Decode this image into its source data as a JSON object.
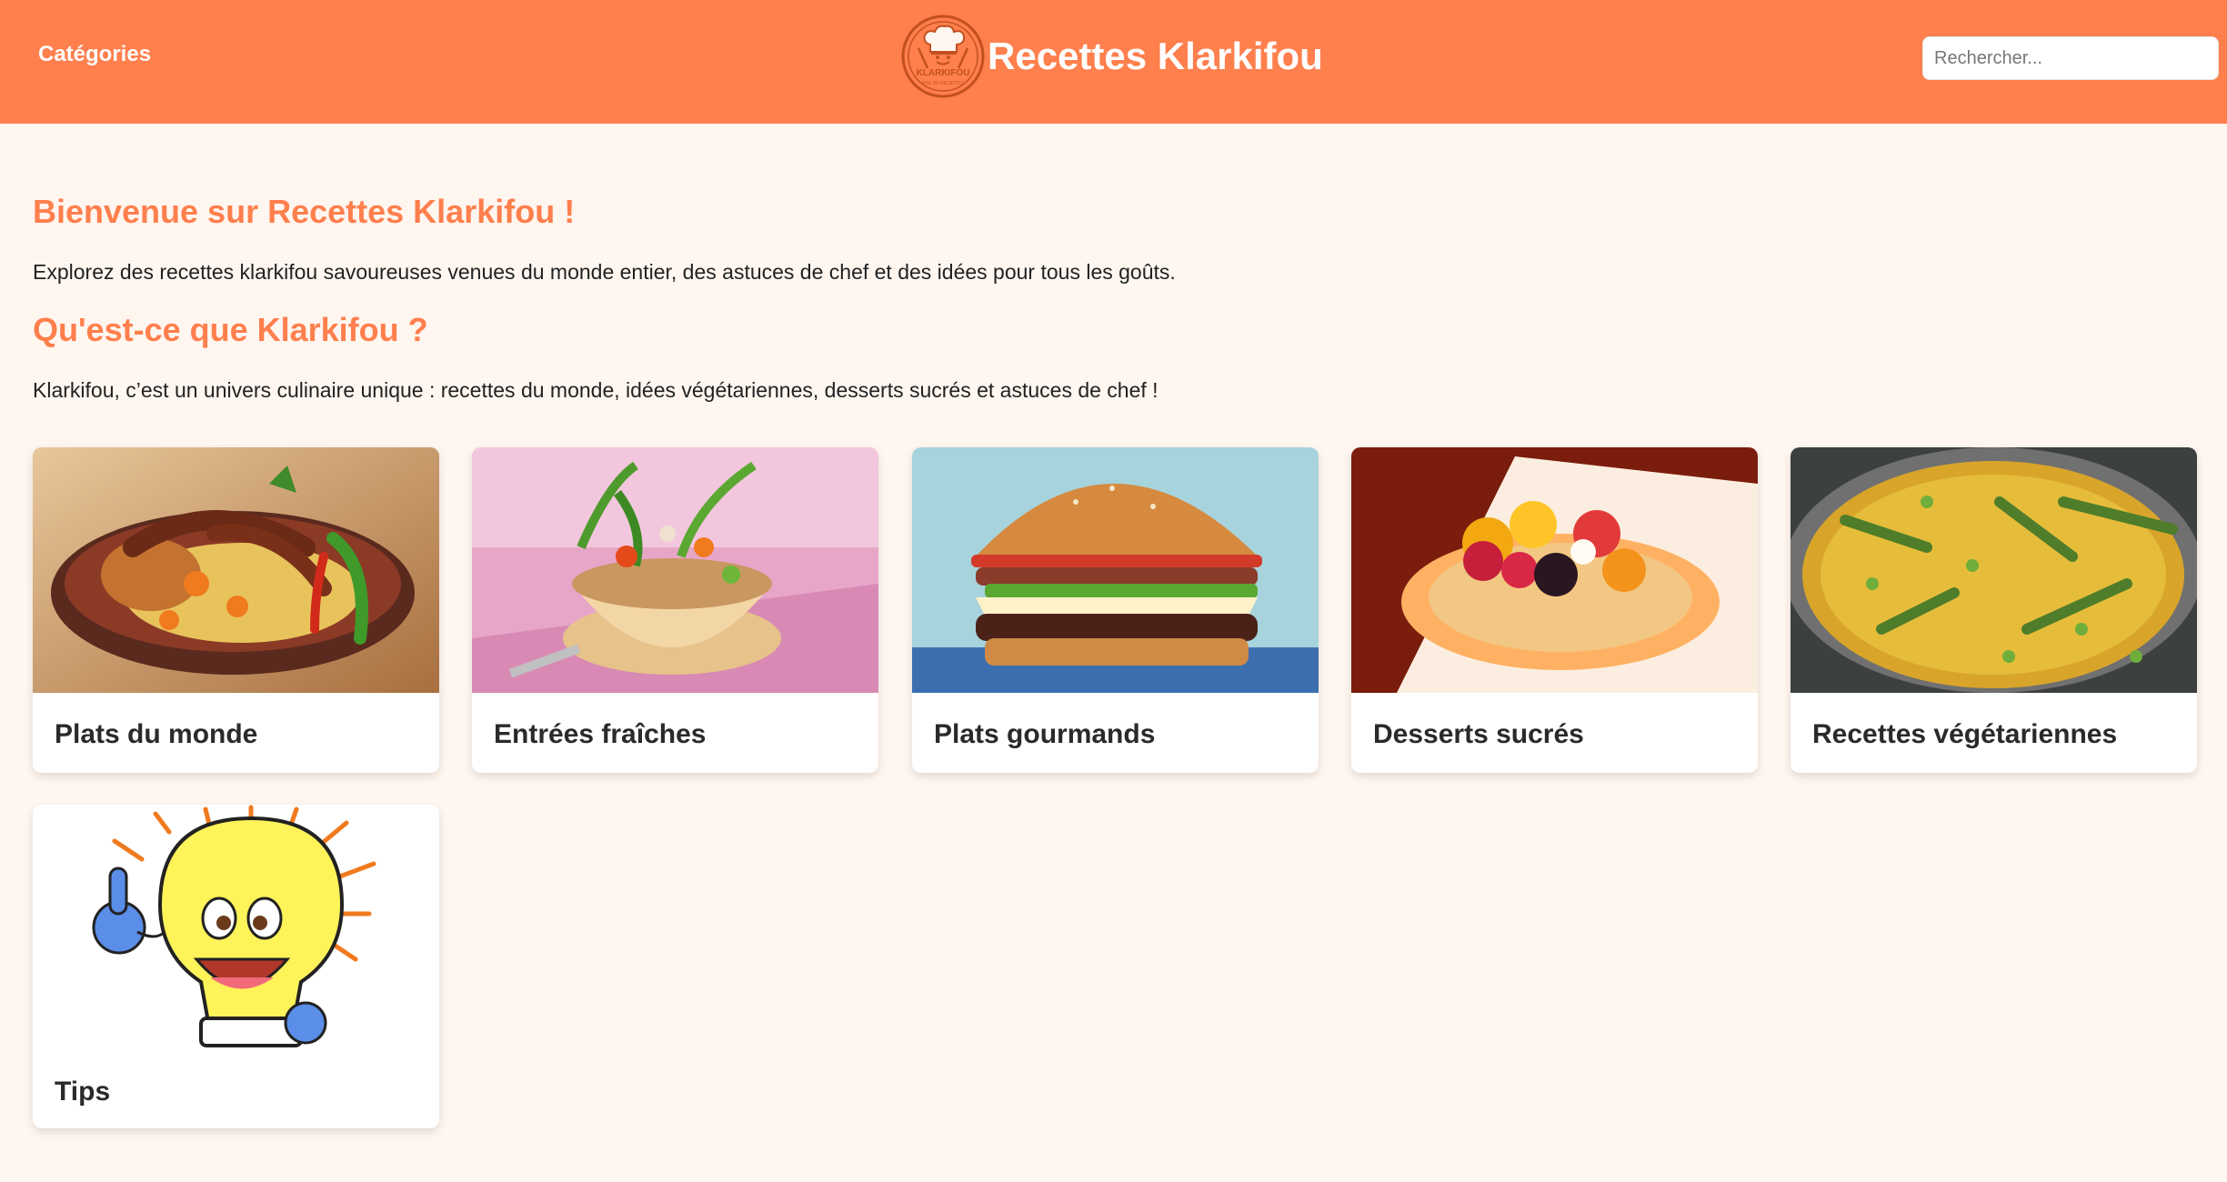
{
  "header": {
    "categories_label": "Catégories",
    "logo_text": "KLARKIFOU",
    "logo_subtext": "SITE DE RECETTES",
    "site_title": "Recettes Klarkifou",
    "search_placeholder": "Rechercher..."
  },
  "intro": {
    "welcome_title": "Bienvenue sur Recettes Klarkifou !",
    "welcome_text": "Explorez des recettes klarkifou savoureuses venues du monde entier, des astuces de chef et des idées pour tous les goûts.",
    "what_title": "Qu'est-ce que Klarkifou ?",
    "what_text": "Klarkifou, c’est un univers culinaire unique : recettes du monde, idées végétariennes, desserts sucrés et astuces de chef !"
  },
  "categories": [
    {
      "label": "Plats du monde"
    },
    {
      "label": "Entrées fraîches"
    },
    {
      "label": "Plats gourmands"
    },
    {
      "label": "Desserts sucrés"
    },
    {
      "label": "Recettes végétariennes"
    },
    {
      "label": "Tips"
    }
  ],
  "colors": {
    "accent": "#ff7f4d",
    "background": "#fff6f0"
  }
}
